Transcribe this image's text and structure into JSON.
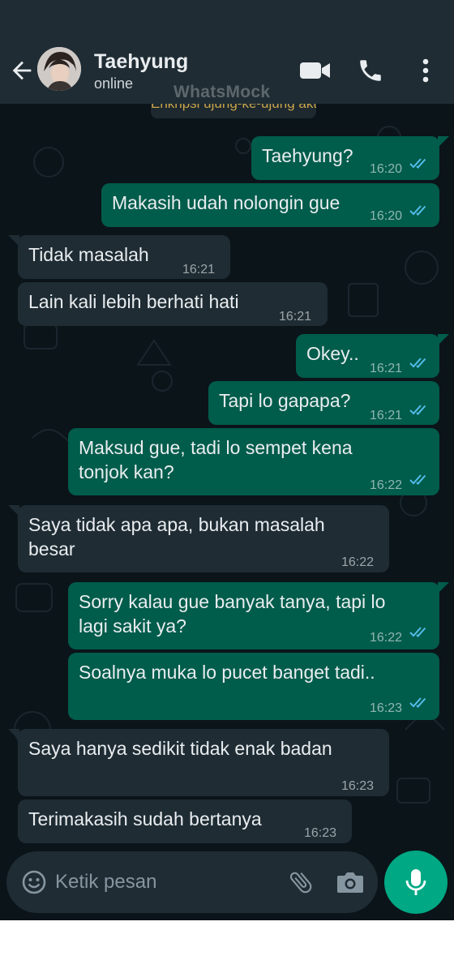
{
  "header": {
    "contact_name": "Taehyung",
    "contact_status": "online",
    "watermark": "WhatsMock"
  },
  "banner": {
    "text": "Enkripsi ujung-ke-ujung aktif di sini"
  },
  "messages": [
    {
      "direction": "out",
      "text": "Taehyung?",
      "time": "16:20",
      "read": true
    },
    {
      "direction": "out",
      "text": "Makasih udah nolongin gue",
      "time": "16:20",
      "read": true
    },
    {
      "direction": "in",
      "text": "Tidak masalah",
      "time": "16:21"
    },
    {
      "direction": "in",
      "text": "Lain kali lebih berhati hati",
      "time": "16:21"
    },
    {
      "direction": "out",
      "text": "Okey..",
      "time": "16:21",
      "read": true
    },
    {
      "direction": "out",
      "text": "Tapi lo gapapa?",
      "time": "16:21",
      "read": true
    },
    {
      "direction": "out",
      "lines": [
        "Maksud gue, tadi lo sempet kena",
        "tonjok kan?"
      ],
      "time": "16:22",
      "read": true
    },
    {
      "direction": "in",
      "lines": [
        "Saya tidak apa apa, bukan masalah",
        "besar"
      ],
      "time": "16:22"
    },
    {
      "direction": "out",
      "lines": [
        "Sorry kalau gue banyak tanya, tapi lo",
        "lagi sakit ya?"
      ],
      "time": "16:22",
      "read": true
    },
    {
      "direction": "out",
      "text": "Soalnya muka lo pucet banget tadi..",
      "time": "16:23",
      "read": true
    },
    {
      "direction": "in",
      "text": "Saya hanya sedikit tidak enak badan",
      "time": "16:23"
    },
    {
      "direction": "in",
      "text": "Terimakasih sudah bertanya",
      "time": "16:23"
    }
  ],
  "composer": {
    "placeholder": "Ketik pesan"
  },
  "colors": {
    "background": "#0b1419",
    "header": "#1f2c34",
    "outgoing_bubble": "#005c4b",
    "incoming_bubble": "#1f2c34",
    "read_ticks": "#53bdeb",
    "accent": "#00a884"
  },
  "icons": [
    "back-arrow-icon",
    "video-call-icon",
    "phone-icon",
    "more-options-icon",
    "double-check-icon",
    "emoji-icon",
    "attachment-icon",
    "camera-icon",
    "microphone-icon"
  ]
}
